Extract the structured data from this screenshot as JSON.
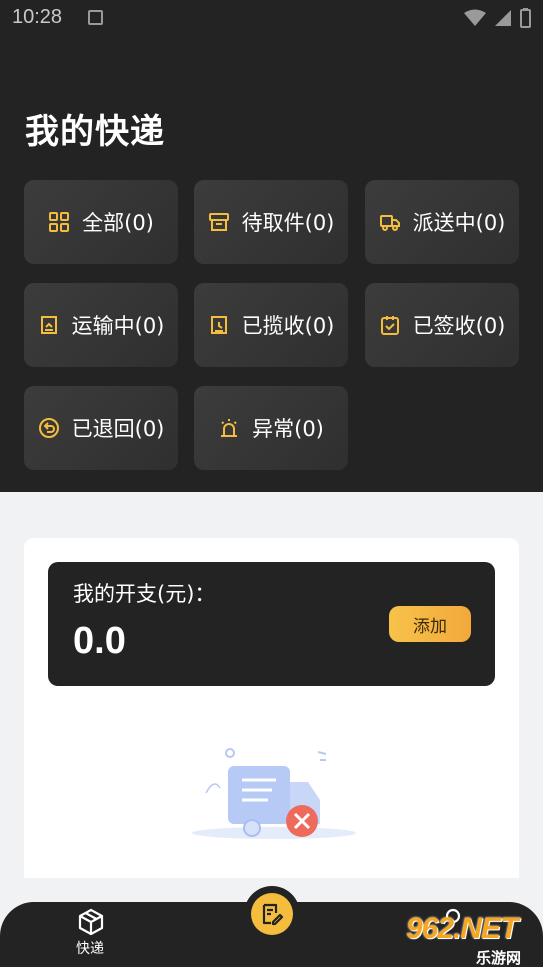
{
  "status_bar": {
    "time": "10:28"
  },
  "header": {
    "title": "我的快递"
  },
  "filters": [
    {
      "label": "全部(0)",
      "icon": "grid-icon"
    },
    {
      "label": "待取件(0)",
      "icon": "box-icon"
    },
    {
      "label": "派送中(0)",
      "icon": "truck-icon"
    },
    {
      "label": "运输中(0)",
      "icon": "transit-icon"
    },
    {
      "label": "已揽收(0)",
      "icon": "collected-icon"
    },
    {
      "label": "已签收(0)",
      "icon": "signed-icon"
    },
    {
      "label": "已退回(0)",
      "icon": "return-icon"
    },
    {
      "label": "异常(0)",
      "icon": "alarm-icon"
    }
  ],
  "expense": {
    "label": "我的开支(元)：",
    "amount": "0.0",
    "add_label": "添加"
  },
  "empty_state": {
    "icon": "empty-truck-error-icon"
  },
  "bottom_nav": {
    "left_label": "快递",
    "center_icon": "edit-document-icon"
  },
  "watermark": {
    "text": "962.NET",
    "sub": "乐游网"
  },
  "colors": {
    "accent": "#f5bd3e",
    "dark": "#232323",
    "background": "#f1f2f4"
  }
}
